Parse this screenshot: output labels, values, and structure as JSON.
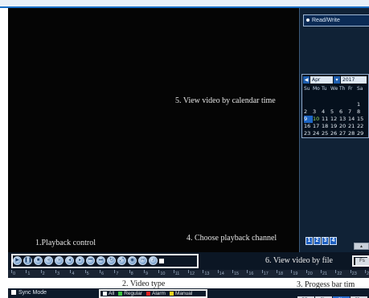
{
  "annotations": {
    "calendar": "5. View video by calendar time",
    "channel": "4. Choose playback channel",
    "playback": "1.Playback control",
    "file": "6. View video by file",
    "type": "2. Video type",
    "progress": "3. Progess bar tim"
  },
  "right_panel": {
    "read_write_label": "Read/Write"
  },
  "calendar": {
    "prev_icon": "left-arrow-icon",
    "month": "Apr",
    "year": "2017",
    "weekdays": [
      "Su",
      "Mo",
      "Tu",
      "We",
      "Th",
      "Fr",
      "Sa"
    ],
    "weeks": [
      [
        "",
        "",
        "",
        "",
        "",
        "",
        "1"
      ],
      [
        "2",
        "3",
        "4",
        "5",
        "6",
        "7",
        "8"
      ],
      [
        "9",
        "10",
        "11",
        "12",
        "13",
        "14",
        "15"
      ],
      [
        "16",
        "17",
        "18",
        "19",
        "20",
        "21",
        "22"
      ],
      [
        "23",
        "24",
        "25",
        "26",
        "27",
        "28",
        "29"
      ],
      [
        "30",
        "",
        "",
        "",
        "",
        "",
        ""
      ]
    ],
    "recorded_day": "10",
    "selected_day": "9"
  },
  "channels": [
    "1",
    "2",
    "3",
    "4"
  ],
  "playback_controls": [
    "play-icon",
    "pause-icon",
    "stop-icon",
    "slow-icon",
    "fast-icon",
    "step-back-icon",
    "step-forward-icon",
    "previous-file-icon",
    "next-file-icon",
    "loop-icon",
    "fullscreen-icon",
    "snapshot-icon",
    "clip-icon",
    "audio-icon"
  ],
  "file_button": "Fs",
  "timeline_ticks": [
    "0",
    "1",
    "2",
    "3",
    "4",
    "5",
    "6",
    "7",
    "8",
    "9",
    "10",
    "11",
    "12",
    "13",
    "14",
    "15",
    "16",
    "17",
    "18",
    "19",
    "20",
    "21",
    "22",
    "23",
    "24"
  ],
  "bottom": {
    "sync_mode": "Sync Mode",
    "video_types": [
      {
        "label": "All",
        "color": "#ffffff"
      },
      {
        "label": "Regular",
        "color": "#3cc43c"
      },
      {
        "label": "Alarm",
        "color": "#e02020"
      },
      {
        "label": "Manual",
        "color": "#f2d21e"
      }
    ],
    "zoom": [
      "24hr",
      "2hr",
      "1hr",
      "30m"
    ],
    "zoom_active": "1hr"
  },
  "colors": {
    "accent_blue": "#1b6fc4",
    "video_bg": "#050505",
    "panel_bg": "#102236"
  }
}
